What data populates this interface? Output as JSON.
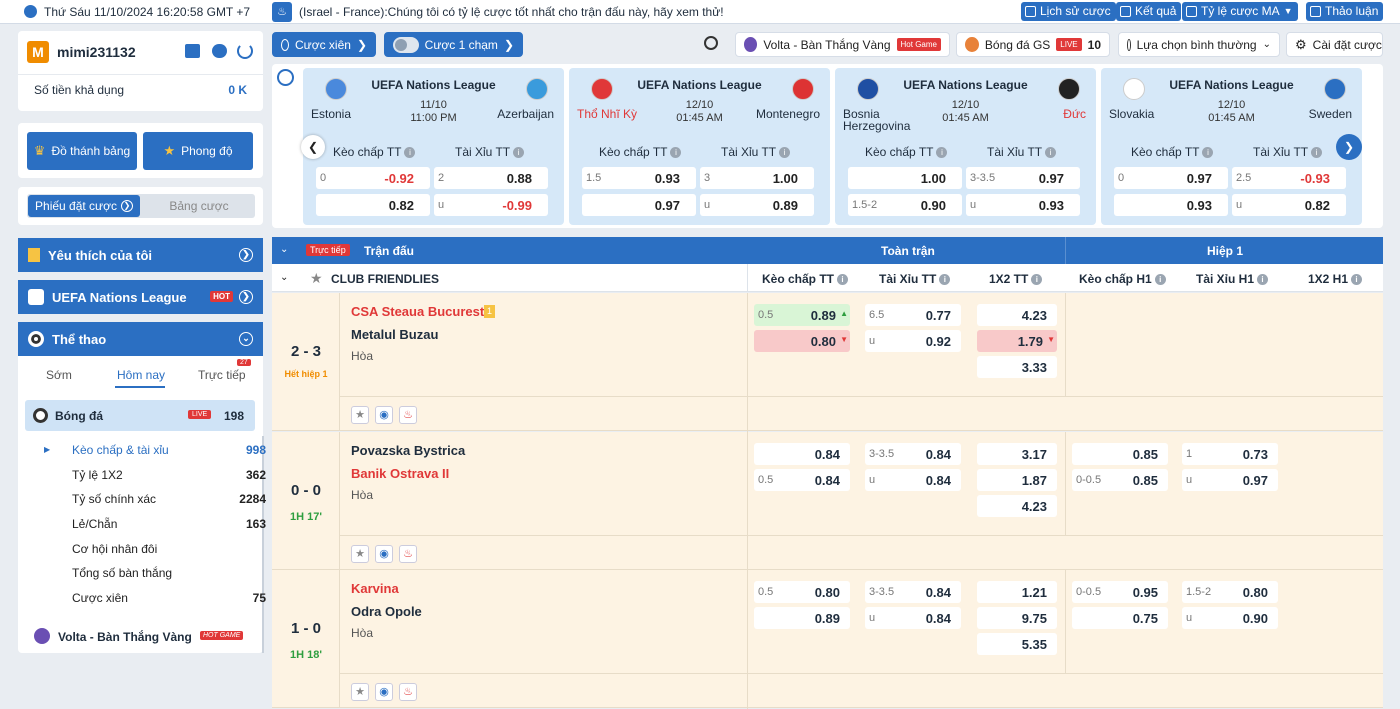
{
  "topbar": {
    "datetime": "Thứ Sáu 11/10/2024 16:20:58 GMT +7",
    "announcement": "(Israel - France):Chúng tôi có tỷ lệ cược tốt nhất cho trận đấu này, hãy xem thử!",
    "buttons": [
      "Lịch sử cược",
      "Kết quả",
      "Tỷ lệ cược MA",
      "Thảo luận"
    ]
  },
  "user": {
    "avatar_letter": "M",
    "username": "mimi231132",
    "balance_label": "Số tiền khả dụng",
    "balance_value": "0 K"
  },
  "sidebar_buttons": {
    "leaderboard": "Đồ thánh bảng",
    "form": "Phong độ"
  },
  "slip_tabs": {
    "active": "Phiếu đặt cược",
    "inactive": "Bảng cược"
  },
  "sidebar": {
    "favorites": "Yêu thích của tôi",
    "league": "UEFA Nations League",
    "hot_badge": "HOT",
    "sports": "Thể thao",
    "time_tabs": [
      "Sớm",
      "Hôm nay",
      "Trực tiếp"
    ],
    "live_count": "27",
    "sport_name": "Bóng đá",
    "live_badge": "LIVE",
    "sport_count": "198",
    "markets": [
      {
        "label": "Kèo chấp & tài xỉu",
        "count": "998"
      },
      {
        "label": "Tỷ lệ 1X2",
        "count": "362"
      },
      {
        "label": "Tỷ số chính xác",
        "count": "2284"
      },
      {
        "label": "Lẻ/Chẵn",
        "count": "163"
      },
      {
        "label": "Cơ hội nhân đôi",
        "count": ""
      },
      {
        "label": "Tổng số bàn thắng",
        "count": ""
      },
      {
        "label": "Cược xiên",
        "count": "75"
      }
    ],
    "volta": "Volta - Bàn Thắng Vàng",
    "hot_game": "HOT GAME"
  },
  "controls": {
    "parlay": "Cược xiên",
    "one_click": "Cược 1 chạm",
    "volta": "Volta - Bàn Thắng Vàng",
    "hot_game": "Hot Game",
    "gs": "Bóng đá GS",
    "gs_live": "LIVE",
    "gs_count": "10",
    "sort": "Lựa chọn bình thường",
    "settings": "Cài đặt cược"
  },
  "featured": [
    {
      "league": "UEFA Nations League",
      "home": "Estonia",
      "away": "Azerbaijan",
      "date": "11/10",
      "time": "11:00 PM",
      "home_color": "#1f2d3d",
      "away_color": "#1f2d3d",
      "ah_label": "Kèo chấp TT",
      "ou_label": "Tài Xỉu TT",
      "cells": [
        {
          "hc": "0",
          "od": "-0.92"
        },
        {
          "hc": "2",
          "od": "0.88"
        },
        {
          "hc": "",
          "od": "0.82"
        },
        {
          "hc": "u",
          "od": "-0.99"
        }
      ]
    },
    {
      "league": "UEFA Nations League",
      "home": "Thổ Nhĩ Kỳ",
      "away": "Montenegro",
      "date": "12/10",
      "time": "01:45 AM",
      "home_color": "#e03838",
      "away_color": "#1f2d3d",
      "ah_label": "Kèo chấp TT",
      "ou_label": "Tài Xỉu TT",
      "cells": [
        {
          "hc": "1.5",
          "od": "0.93"
        },
        {
          "hc": "3",
          "od": "1.00"
        },
        {
          "hc": "",
          "od": "0.97"
        },
        {
          "hc": "u",
          "od": "0.89"
        }
      ]
    },
    {
      "league": "UEFA Nations League",
      "home": "Bosnia Herzegovina",
      "away": "Đức",
      "date": "12/10",
      "time": "01:45 AM",
      "home_color": "#1f2d3d",
      "away_color": "#e03838",
      "ah_label": "Kèo chấp TT",
      "ou_label": "Tài Xỉu TT",
      "cells": [
        {
          "hc": "",
          "od": "1.00"
        },
        {
          "hc": "3-3.5",
          "od": "0.97"
        },
        {
          "hc": "1.5-2",
          "od": "0.90"
        },
        {
          "hc": "u",
          "od": "0.93"
        }
      ]
    },
    {
      "league": "UEFA Nations League",
      "home": "Slovakia",
      "away": "Sweden",
      "date": "12/10",
      "time": "01:45 AM",
      "home_color": "#1f2d3d",
      "away_color": "#1f2d3d",
      "ah_label": "Kèo chấp TT",
      "ou_label": "Tài Xỉu TT",
      "cells": [
        {
          "hc": "0",
          "od": "0.97"
        },
        {
          "hc": "2.5",
          "od": "-0.93"
        },
        {
          "hc": "",
          "od": "0.93"
        },
        {
          "hc": "u",
          "od": "0.82"
        }
      ]
    }
  ],
  "table": {
    "live_badge": "Trực tiếp",
    "match_label": "Trận đấu",
    "fulltime": "Toàn trận",
    "half": "Hiệp 1",
    "league": "CLUB FRIENDLIES",
    "cols": [
      "Kèo chấp TT",
      "Tài Xỉu TT",
      "1X2 TT",
      "Kèo chấp H1",
      "Tài Xỉu H1",
      "1X2 H1"
    ]
  },
  "matches": [
    {
      "score": "2 - 3",
      "status": "Hết hiệp 1",
      "status_color": "#f08c00",
      "home": "CSA Steaua Bucuresti",
      "away": "Metalul Buzau",
      "home_red": true,
      "away_red": false,
      "card": "1",
      "draw": "Hòa",
      "ah": [
        {
          "hc": "0.5",
          "od": "0.89",
          "st": "up"
        },
        {
          "hc": "",
          "od": "0.80",
          "st": "down"
        }
      ],
      "ou": [
        {
          "hc": "6.5",
          "od": "0.77"
        },
        {
          "hc": "u",
          "od": "0.92"
        }
      ],
      "x12": [
        {
          "od": "4.23"
        },
        {
          "od": "1.79",
          "st": "down"
        },
        {
          "od": "3.33"
        }
      ],
      "ah1": [],
      "ou1": []
    },
    {
      "score": "0 - 0",
      "status": "1H 17'",
      "status_color": "#2e9e3f",
      "home": "Povazska Bystrica",
      "away": "Banik Ostrava II",
      "home_red": false,
      "away_red": true,
      "card": "",
      "draw": "Hòa",
      "ah": [
        {
          "hc": "",
          "od": "0.84"
        },
        {
          "hc": "0.5",
          "od": "0.84"
        }
      ],
      "ou": [
        {
          "hc": "3-3.5",
          "od": "0.84"
        },
        {
          "hc": "u",
          "od": "0.84"
        }
      ],
      "x12": [
        {
          "od": "3.17"
        },
        {
          "od": "1.87"
        },
        {
          "od": "4.23"
        }
      ],
      "ah1": [
        {
          "hc": "",
          "od": "0.85"
        },
        {
          "hc": "0-0.5",
          "od": "0.85"
        }
      ],
      "ou1": [
        {
          "hc": "1",
          "od": "0.73"
        },
        {
          "hc": "u",
          "od": "0.97"
        }
      ]
    },
    {
      "score": "1 - 0",
      "status": "1H 18'",
      "status_color": "#2e9e3f",
      "home": "Karvina",
      "away": "Odra Opole",
      "home_red": true,
      "away_red": false,
      "card": "",
      "draw": "Hòa",
      "ah": [
        {
          "hc": "0.5",
          "od": "0.80"
        },
        {
          "hc": "",
          "od": "0.89"
        }
      ],
      "ou": [
        {
          "hc": "3-3.5",
          "od": "0.84"
        },
        {
          "hc": "u",
          "od": "0.84"
        }
      ],
      "x12": [
        {
          "od": "1.21"
        },
        {
          "od": "9.75"
        },
        {
          "od": "5.35"
        }
      ],
      "ah1": [
        {
          "hc": "0-0.5",
          "od": "0.95"
        },
        {
          "hc": "",
          "od": "0.75"
        }
      ],
      "ou1": [
        {
          "hc": "1.5-2",
          "od": "0.80"
        },
        {
          "hc": "u",
          "od": "0.90"
        }
      ]
    }
  ]
}
